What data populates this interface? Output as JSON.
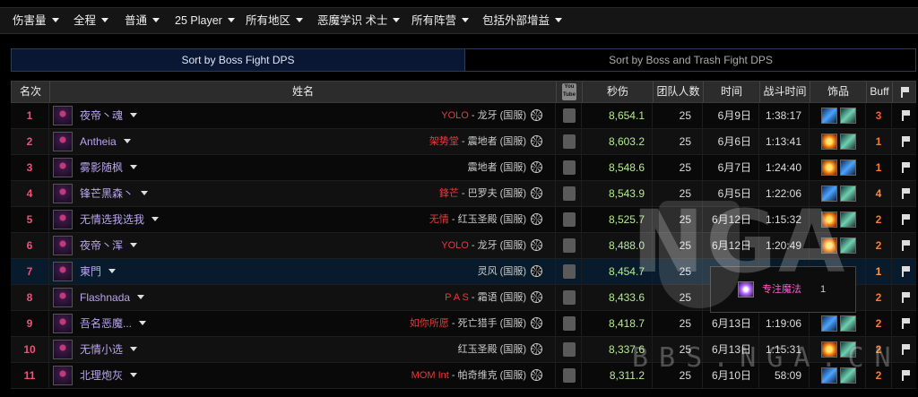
{
  "filters": [
    {
      "label": "伤害量"
    },
    {
      "label": "全程"
    },
    {
      "label": "普通"
    },
    {
      "label": "25 Player"
    },
    {
      "label": "所有地区"
    },
    {
      "label": "恶魔学识 术士"
    },
    {
      "label": "所有阵营"
    },
    {
      "label": "包括外部增益"
    }
  ],
  "tabs": {
    "active": "Sort by Boss Fight DPS",
    "inactive": "Sort by Boss and Trash Fight DPS"
  },
  "columns": {
    "rank": "名次",
    "name": "姓名",
    "video_top": "You",
    "video_bottom": "Tube",
    "dps": "秒伤",
    "raid_size": "团队人数",
    "date": "时间",
    "duration": "战斗时间",
    "items": "饰品",
    "buff": "Buff"
  },
  "rows": [
    {
      "rank": "1",
      "name": "夜帝丶魂",
      "guild": "YOLO",
      "realm": " - 龙牙 (国服)",
      "dps": "8,654.1",
      "raid": "25",
      "date": "6月9日",
      "duration": "1:38:17",
      "items": [
        "blue",
        "teal"
      ],
      "buff": "3",
      "buff_color": "#ff5a1f"
    },
    {
      "rank": "2",
      "name": "Antheia",
      "guild": "架势堂",
      "realm": " - 震地者 (国服)",
      "dps": "8,603.2",
      "raid": "25",
      "date": "6月6日",
      "duration": "1:13:41",
      "items": [
        "fire",
        "teal"
      ],
      "buff": "1",
      "buff_color": "#ff7a2a"
    },
    {
      "rank": "3",
      "name": "雾影随枫",
      "guild": "",
      "realm": "震地者 (国服)",
      "dps": "8,548.6",
      "raid": "25",
      "date": "6月7日",
      "duration": "1:24:40",
      "items": [
        "fire",
        "blue"
      ],
      "buff": "1",
      "buff_color": "#ff7a2a"
    },
    {
      "rank": "4",
      "name": "锋芒黑森丶",
      "guild": "鋒芒",
      "realm": " - 巴罗夫 (国服)",
      "dps": "8,543.9",
      "raid": "25",
      "date": "6月5日",
      "duration": "1:22:06",
      "items": [
        "blue",
        "teal"
      ],
      "buff": "4",
      "buff_color": "#ff8a3a"
    },
    {
      "rank": "5",
      "name": "无情选我选我",
      "guild": "无情",
      "realm": " - 红玉圣殿 (国服)",
      "dps": "8,525.7",
      "raid": "25",
      "date": "6月12日",
      "duration": "1:15:32",
      "items": [
        "fire",
        "teal"
      ],
      "buff": "2",
      "buff_color": "#ff7a2a"
    },
    {
      "rank": "6",
      "name": "夜帝丶浑",
      "guild": "YOLO",
      "realm": " - 龙牙 (国服)",
      "dps": "8,488.0",
      "raid": "25",
      "date": "6月12日",
      "duration": "1:20:49",
      "items": [
        "fire",
        "teal"
      ],
      "buff": "2",
      "buff_color": "#ff7a2a"
    },
    {
      "rank": "7",
      "name": "東門",
      "guild": "",
      "realm": "灵风 (国服)",
      "dps": "8,454.7",
      "raid": "25",
      "date": "",
      "duration": "",
      "items": [],
      "buff": "1",
      "buff_color": "#ff9a4a"
    },
    {
      "rank": "8",
      "name": "Flashnada",
      "guild": "P A S",
      "realm": " - 霜语 (国服)",
      "dps": "8,433.6",
      "raid": "25",
      "date": "",
      "duration": "",
      "items": [],
      "buff": "2",
      "buff_color": "#ff7a2a"
    },
    {
      "rank": "9",
      "name": "吾名恶魔...",
      "guild": "如你所愿",
      "realm": " - 死亡猎手 (国服)",
      "dps": "8,418.7",
      "raid": "25",
      "date": "6月13日",
      "duration": "1:19:06",
      "items": [
        "blue",
        "teal"
      ],
      "buff": "2",
      "buff_color": "#ff7a2a"
    },
    {
      "rank": "10",
      "name": "无情小选",
      "guild": "",
      "realm": "红玉圣殿 (国服)",
      "dps": "8,337.6",
      "raid": "25",
      "date": "6月13日",
      "duration": "1:15:31",
      "items": [
        "fire",
        "teal"
      ],
      "buff": "2",
      "buff_color": "#ff7a2a"
    },
    {
      "rank": "11",
      "name": "北理炮灰",
      "guild": "MOM Int",
      "realm": " - 帕奇维克 (国服)",
      "dps": "8,311.2",
      "raid": "25",
      "date": "6月10日",
      "duration": "58:09",
      "items": [
        "blue",
        "teal"
      ],
      "buff": "2",
      "buff_color": "#ff7a2a"
    }
  ],
  "tooltip": {
    "name": "专注魔法",
    "count": "1"
  },
  "watermark": {
    "logo": "NGA",
    "url": "BBS.NGA.CN"
  }
}
